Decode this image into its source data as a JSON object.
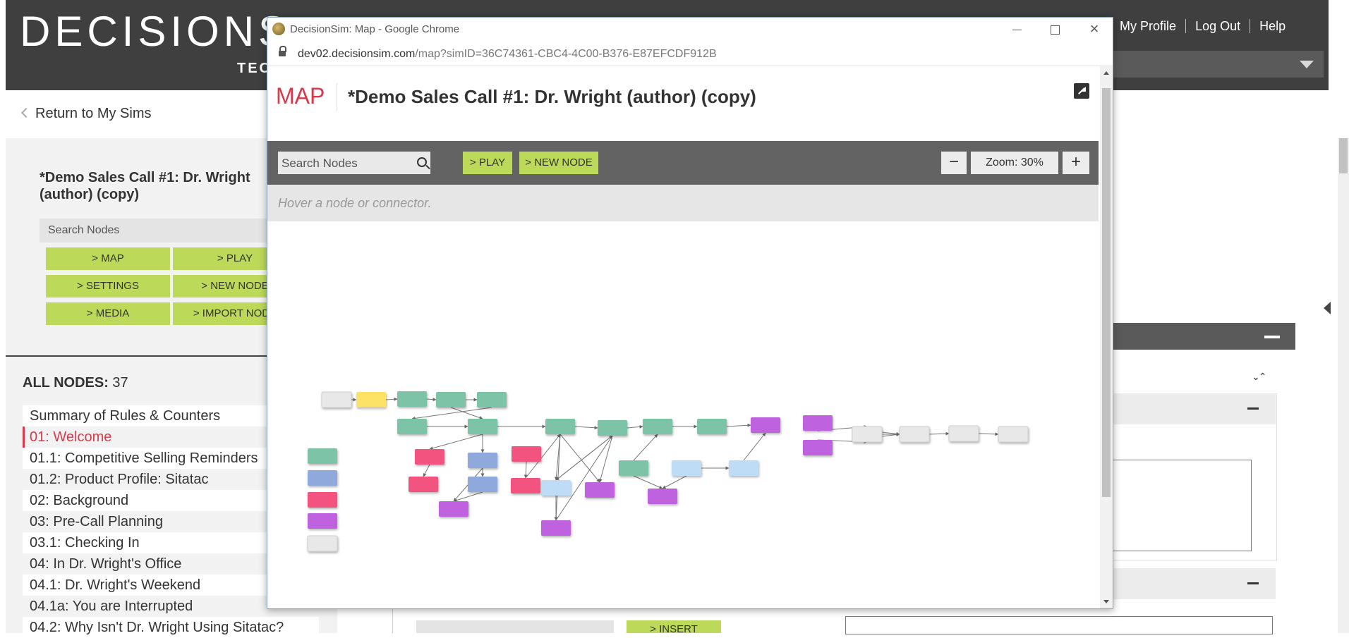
{
  "app": {
    "logo": "DECISIONS",
    "logo_sub": "TEC",
    "nav": [
      "My Profile",
      "Log Out",
      "Help"
    ],
    "return_link": "Return to My Sims",
    "sim_title": "*Demo Sales Call #1: Dr. Wright (author) (copy)",
    "search_placeholder": "Search Nodes",
    "buttons": [
      "> MAP",
      "> PLAY",
      "> SETTINGS",
      "> NEW NODE",
      "> MEDIA",
      "> IMPORT NODE"
    ],
    "all_nodes_label": "ALL NODES:",
    "all_nodes_count": "37",
    "nodes": [
      "Summary of Rules & Counters",
      "01: Welcome",
      "01.1: Competitive Selling Reminders",
      "01.2: Product Profile: Sitatac",
      "02: Background",
      "03: Pre-Call Planning",
      "03.1: Checking In",
      "04: In Dr. Wright's Office",
      "04.1: Dr. Wright's Weekend",
      "04.1a: You are Interrupted",
      "04.2: Why Isn't Dr. Wright Using Sitatac?"
    ],
    "active_node_index": 1,
    "insert_button": "> INSERT"
  },
  "chrome": {
    "title": "DecisionSim: Map - Google Chrome",
    "url_host": "dev02.decisionsim.com",
    "url_path": "/map?simID=36C74361-CBC4-4C00-B376-E87EFCDF912B"
  },
  "map": {
    "label": "MAP",
    "title": "*Demo Sales Call #1: Dr. Wright (author) (copy)",
    "search_placeholder": "Search Nodes",
    "play_button": "> PLAY",
    "new_node_button": "> NEW NODE",
    "zoom_minus": "−",
    "zoom_label": "Zoom: 30%",
    "zoom_plus": "+",
    "hover_hint": "Hover a node or connector."
  },
  "colors": {
    "accent_red": "#d9394a",
    "button_green": "#bcd95a",
    "header_dark": "#3f3f3f",
    "toolbar_gray": "#636363",
    "node_teal": "#7dc3a7",
    "node_blue": "#8fa9dc",
    "node_pink": "#f2537f",
    "node_purple": "#be62e0",
    "node_gray": "#e8e8e8",
    "node_yellow": "#fde365",
    "node_lightblue": "#bedcf5"
  }
}
